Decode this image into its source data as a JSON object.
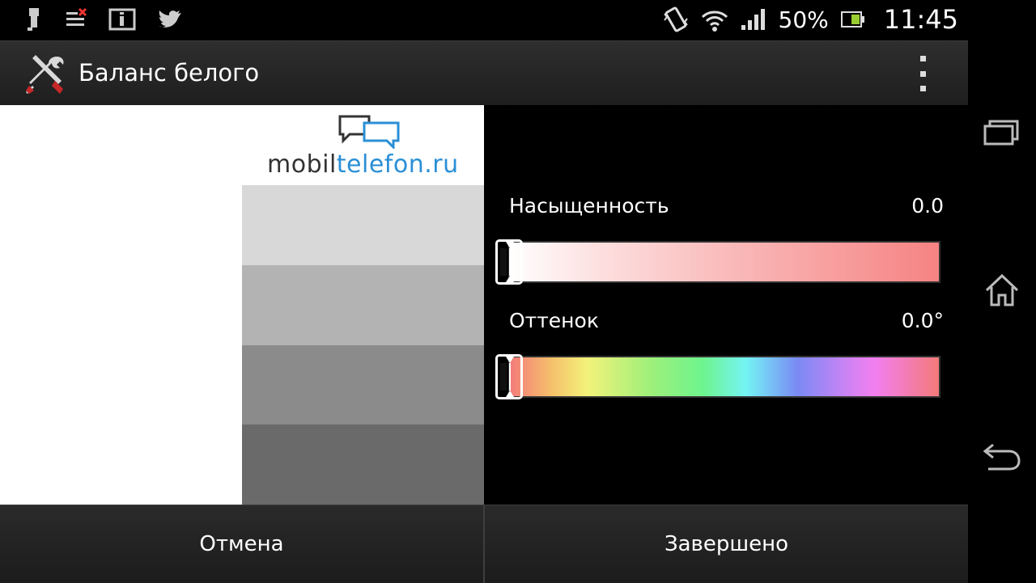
{
  "status_bar": {
    "battery_percent": "50%",
    "time": "11:45",
    "icons": [
      "usb-debug-icon",
      "notification-icon",
      "info-icon",
      "twitter-icon",
      "vibrate-icon",
      "wifi-icon",
      "signal-icon",
      "battery-icon"
    ]
  },
  "action_bar": {
    "title": "Баланс белого",
    "app_icon": "tools-icon",
    "overflow_icon": "overflow-menu-icon"
  },
  "preview": {
    "logo_part1": "mobil",
    "logo_part2": "telefon.ru",
    "swatch_colors": [
      "#d8d8d8",
      "#b3b3b3",
      "#8b8b8b",
      "#6a6a6a"
    ]
  },
  "controls": {
    "saturation": {
      "label": "Насыщенность",
      "value": "0.0",
      "level": 0
    },
    "hue": {
      "label": "Оттенок",
      "value": "0.0°",
      "level": 0
    }
  },
  "buttons": {
    "cancel": "Отмена",
    "done": "Завершено"
  },
  "nav_bar": {
    "icons": [
      "recent-apps-icon",
      "home-icon",
      "back-icon"
    ]
  }
}
